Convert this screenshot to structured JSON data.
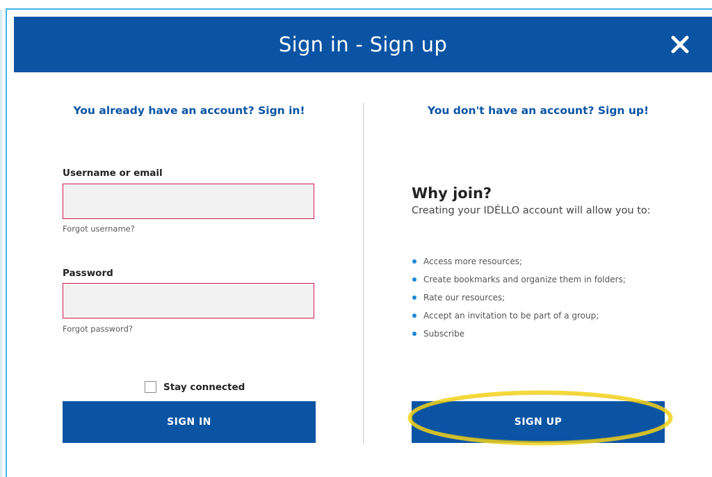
{
  "modal": {
    "title": "Sign in - Sign up",
    "close_icon": "close-icon"
  },
  "signin": {
    "heading": "You already have an account? Sign in!",
    "username_label": "Username or email",
    "username_value": "",
    "forgot_username": "Forgot username?",
    "password_label": "Password",
    "password_value": "",
    "forgot_password": "Forgot password?",
    "stay_connected": "Stay connected",
    "stay_connected_checked": false,
    "button": "SIGN IN"
  },
  "signup": {
    "heading": "You don't have an account? Sign up!",
    "why_title": "Why join?",
    "why_desc": "Creating your IDÉLLO account will allow you to:",
    "benefits": [
      "Access more resources;",
      "Create bookmarks and organize them in folders;",
      "Rate our resources;",
      "Accept an invitation to be part of a group;",
      "Subscribe"
    ],
    "button": "SIGN UP"
  },
  "colors": {
    "header_bg": "#0b54a4",
    "button_bg": "#0b54a4",
    "heading_text": "#0b54a4",
    "input_border": "#d6184f",
    "bullet": "#1688d8",
    "highlight": "#f2d21b"
  }
}
